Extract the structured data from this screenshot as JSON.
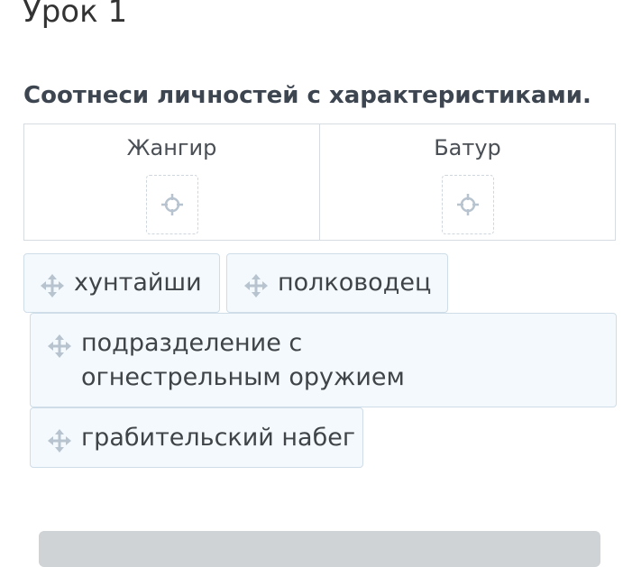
{
  "lesson": {
    "title": "Урок 1"
  },
  "task": {
    "title": "Соотнеси личностей с характеристиками."
  },
  "columns": [
    {
      "label": "Жангир"
    },
    {
      "label": "Батур"
    }
  ],
  "chips": [
    {
      "label": "хунтайши"
    },
    {
      "label": "полководец"
    },
    {
      "label": "подразделение с огнестрельным оружием"
    },
    {
      "label": "грабительский набег"
    }
  ],
  "icons": {
    "move": "move-arrows-icon",
    "target": "crosshair-icon"
  },
  "colors": {
    "chip_bg": "#f4f9fd",
    "chip_border": "#cfdde9",
    "icon": "#b7c3ce",
    "button": "#d0d3d6"
  }
}
